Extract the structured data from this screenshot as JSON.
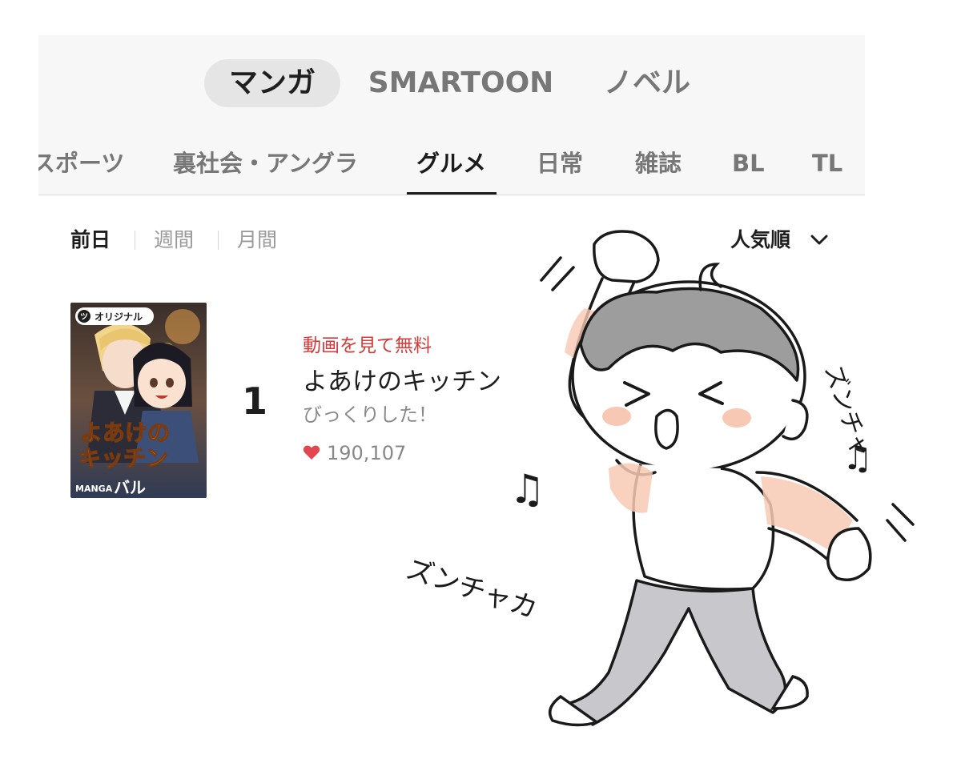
{
  "top_tabs": [
    {
      "label": "マンガ",
      "active": true
    },
    {
      "label": "SMARTOON",
      "active": false
    },
    {
      "label": "ノベル",
      "active": false
    }
  ],
  "genres": [
    {
      "label": "スポーツ"
    },
    {
      "label": "裏社会・アングラ"
    },
    {
      "label": "グルメ",
      "active": true
    },
    {
      "label": "日常"
    },
    {
      "label": "雑誌"
    },
    {
      "label": "BL"
    },
    {
      "label": "TL"
    }
  ],
  "periods": [
    {
      "label": "前日",
      "active": true
    },
    {
      "label": "週間"
    },
    {
      "label": "月間"
    }
  ],
  "sort": {
    "label": "人気順"
  },
  "ranking": [
    {
      "rank": "1",
      "promo": "動画を見て無料",
      "title": "よあけのキッチン",
      "subtitle": "びっくりした！",
      "likes": "190,107",
      "cover": {
        "badge": "オリジナル",
        "badge_mark": "ツ",
        "title_line1": "よあけの",
        "title_line2": "キッチン",
        "label_small": "MANGA",
        "label_big": "バル"
      }
    }
  ],
  "doodle": {
    "sound_1": "ズンチャ",
    "sound_2": "ズンチャカ",
    "note": "♫"
  },
  "colors": {
    "accent_red": "#d53b3b",
    "heart": "#e2474f",
    "skin_blush": "#f7c9b4"
  }
}
